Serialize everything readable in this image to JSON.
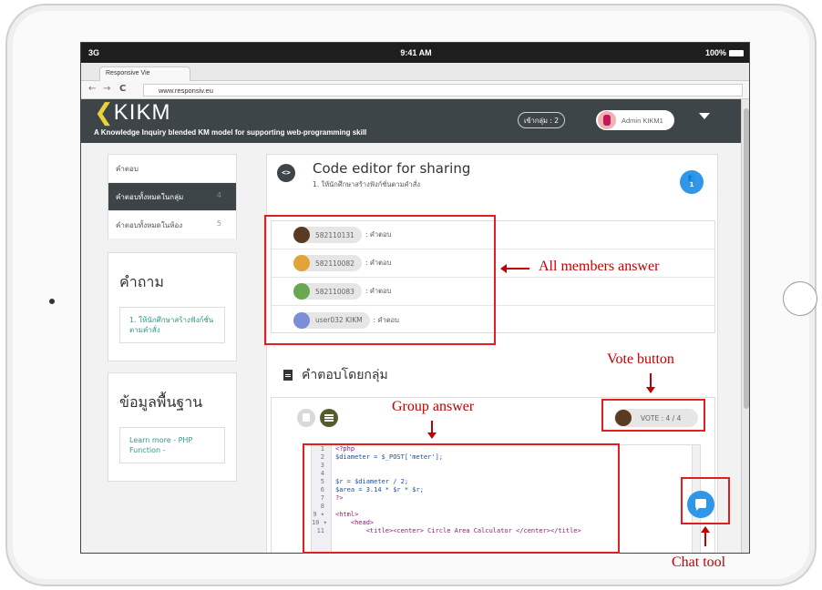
{
  "statusbar": {
    "signal": "3G",
    "time": "9:41 AM",
    "battery": "100%"
  },
  "browser": {
    "tab_title": "Responsive Vie",
    "url": "www.responsiv.eu",
    "back": "←",
    "forward": "→",
    "reload": "C"
  },
  "header": {
    "logo": "KIKM",
    "logo_chevron": "❮",
    "tagline": "A Knowledge Inquiry blended KM model for supporting web-programming skill",
    "group_pill": "เข้ากลุ่ม : 2",
    "admin_name": "Admin KIKM1"
  },
  "sidebar": {
    "items": [
      {
        "label": "คำตอบ",
        "count": ""
      },
      {
        "label": "คำตอบทั้งหมดในกลุ่ม",
        "count": "4"
      },
      {
        "label": "คำตอบทั้งหมดในห้อง",
        "count": "5"
      }
    ],
    "question_title": "คำถาม",
    "question_link": "1. ให้นักศึกษาสร้างฟังก์ชั่นตามคำสั่ง",
    "basics_title": "ข้อมูลพื้นฐาน",
    "basics_link": "Learn more - PHP Function -"
  },
  "main": {
    "code_icon": "<>",
    "title": "Code editor for sharing",
    "subtitle": "1. ให้นักศึกษาสร้างฟังก์ชั่นตามคำสั่ง",
    "members_count": "1",
    "members": [
      {
        "id": "582110131",
        "answer": ": คำตอบ",
        "color": "#5a3b22"
      },
      {
        "id": "582110082",
        "answer": ": คำตอบ",
        "color": "#e0a43a"
      },
      {
        "id": "582110083",
        "answer": ": คำตอบ",
        "color": "#6aa84f"
      },
      {
        "id": "user032 KIKM",
        "answer": ": คำตอบ",
        "color": "#7a8fd6"
      }
    ],
    "group_heading": "คำตอบโดยกลุ่ม",
    "vote_label": "VOTE : 4 / 4",
    "code_lines": [
      {
        "n": "1",
        "t": "<?php",
        "k": "tag"
      },
      {
        "n": "2",
        "t": "$diameter = $_POST['meter'];",
        "k": "var"
      },
      {
        "n": "3",
        "t": "",
        "k": ""
      },
      {
        "n": "4",
        "t": "",
        "k": ""
      },
      {
        "n": "5",
        "t": "$r = $diameter / 2;",
        "k": "var"
      },
      {
        "n": "6",
        "t": "$area = 3.14 * $r * $r;",
        "k": "var"
      },
      {
        "n": "7",
        "t": "?>",
        "k": "tag"
      },
      {
        "n": "8",
        "t": "",
        "k": ""
      },
      {
        "n": "9 ▾",
        "t": "<html>",
        "k": "tag"
      },
      {
        "n": "10 ▾",
        "t": "    <head>",
        "k": "tag"
      },
      {
        "n": "11",
        "t": "        <title><center> Circle Area Calculator </center></title>",
        "k": "tag"
      }
    ]
  },
  "annotations": {
    "members": "All members answer",
    "vote": "Vote button",
    "group": "Group answer",
    "chat": "Chat tool"
  },
  "colors": {
    "header_bg": "#3d4548",
    "logo_accent": "#e8d23a",
    "fab_blue": "#2f96e8",
    "annotation_red": "#c00000",
    "link_teal": "#2e9a8a"
  }
}
